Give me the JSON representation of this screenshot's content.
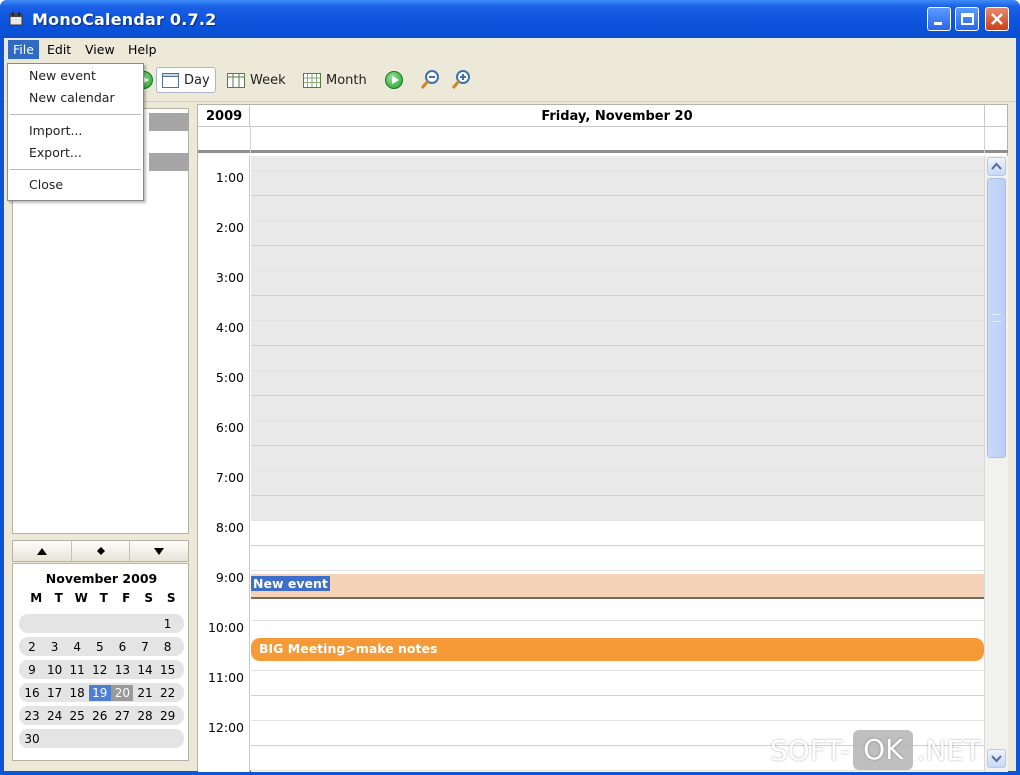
{
  "window": {
    "title": "MonoCalendar 0.7.2"
  },
  "menubar": {
    "items": [
      "File",
      "Edit",
      "View",
      "Help"
    ]
  },
  "file_menu": {
    "items": [
      "New event",
      "New calendar",
      "Import...",
      "Export...",
      "Close"
    ]
  },
  "toolbar": {
    "day_label": "Day",
    "week_label": "Week",
    "month_label": "Month",
    "active_view": "Day"
  },
  "minical": {
    "month_title": "November 2009",
    "dows": [
      "M",
      "T",
      "W",
      "T",
      "F",
      "S",
      "S"
    ],
    "weeks": [
      [
        "",
        "",
        "",
        "",
        "",
        "",
        "1"
      ],
      [
        "2",
        "3",
        "4",
        "5",
        "6",
        "7",
        "8"
      ],
      [
        "9",
        "10",
        "11",
        "12",
        "13",
        "14",
        "15"
      ],
      [
        "16",
        "17",
        "18",
        "19",
        "20",
        "21",
        "22"
      ],
      [
        "23",
        "24",
        "25",
        "26",
        "27",
        "28",
        "29"
      ],
      [
        "30",
        "",
        "",
        "",
        "",
        "",
        ""
      ]
    ],
    "today": "19",
    "selected": "20"
  },
  "dayview": {
    "year": "2009",
    "date_header": "Friday, November 20",
    "hour_labels": [
      "1:00",
      "2:00",
      "3:00",
      "4:00",
      "5:00",
      "6:00",
      "7:00",
      "8:00",
      "9:00",
      "10:00",
      "11:00",
      "12:00"
    ],
    "events": [
      {
        "title": "New event",
        "start_hour": 9.17,
        "end_hour": 9.6,
        "color": "#f6d3b7"
      },
      {
        "title": "BIG Meeting>make notes",
        "start_hour": 10.45,
        "end_hour": 10.95,
        "color": "#f59a36"
      }
    ],
    "working_hours_start": 8.17
  },
  "colors": {
    "titlebar": "#0c54dc",
    "menu_highlight": "#316ac5",
    "today_cell": "#4d7fd0",
    "event_orange": "#f59a36"
  },
  "watermark": {
    "left": "SOFT-",
    "middle": "OK",
    "right": ".NET"
  }
}
